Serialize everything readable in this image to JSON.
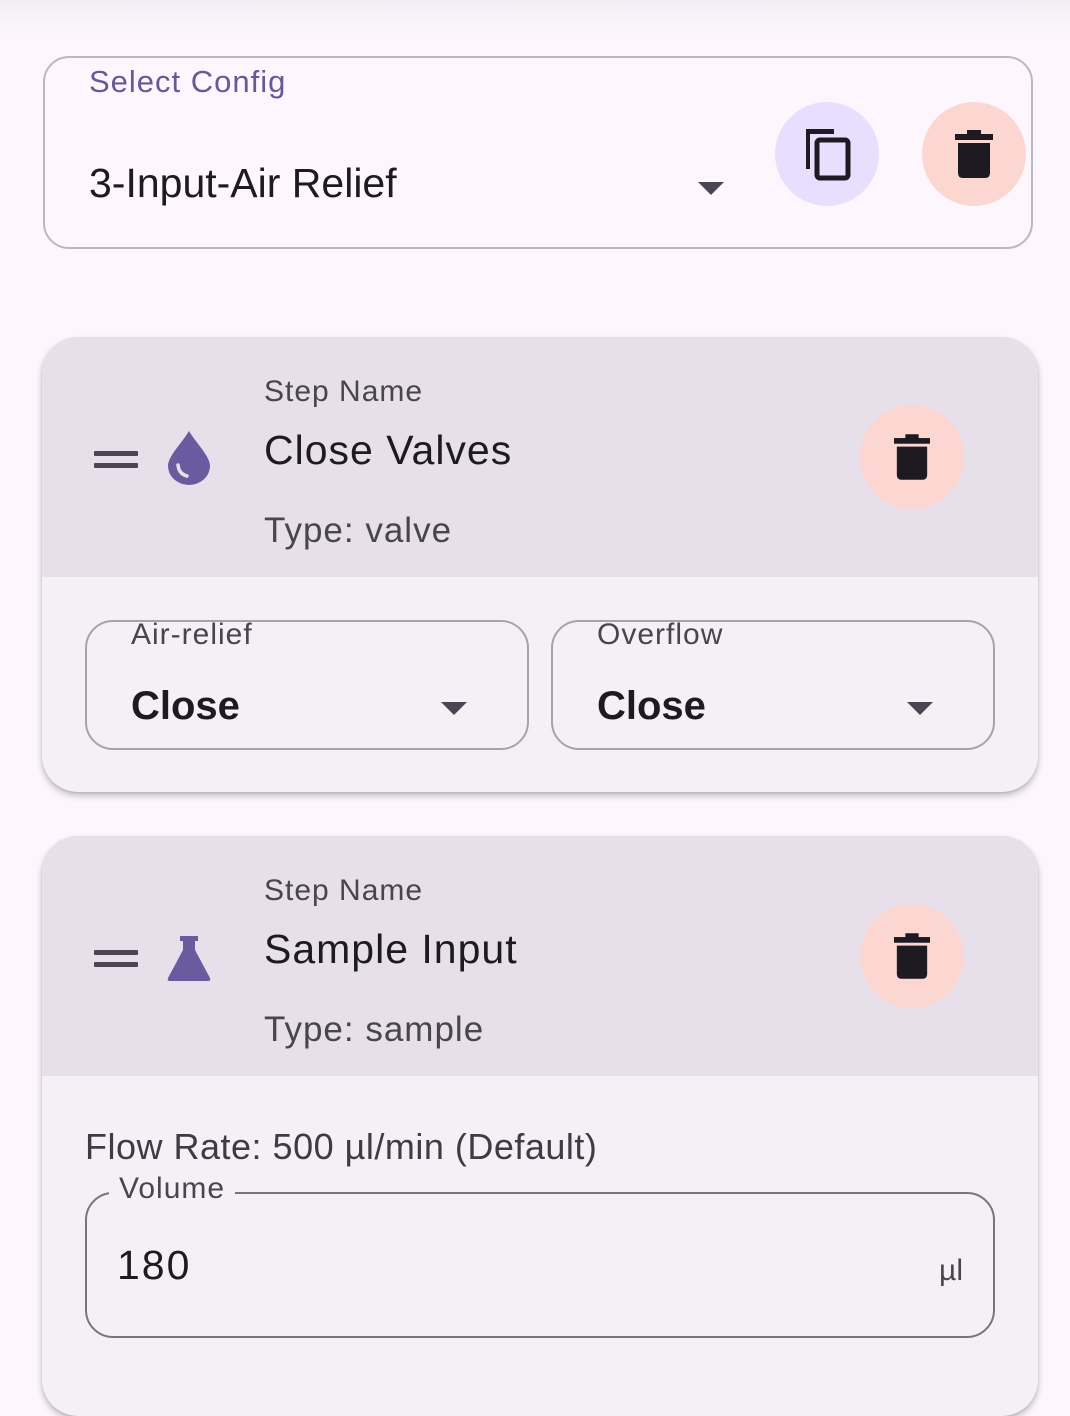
{
  "config": {
    "label": "Select Config",
    "selected": "3-Input-Air Relief",
    "copy_icon": "copy-icon",
    "delete_icon": "trash-icon"
  },
  "steps": [
    {
      "name_label": "Step Name",
      "name": "Close Valves",
      "type_text": "Type: valve",
      "icon": "water-drop-icon",
      "valves": [
        {
          "label": "Air-relief",
          "value": "Close"
        },
        {
          "label": "Overflow",
          "value": "Close"
        }
      ]
    },
    {
      "name_label": "Step Name",
      "name": "Sample Input",
      "type_text": "Type: sample",
      "icon": "flask-icon",
      "flow_rate": "Flow Rate: 500 µl/min (Default)",
      "volume": {
        "label": "Volume",
        "value": "180",
        "unit": "µl"
      }
    }
  ],
  "colors": {
    "background": "#fdf7fd",
    "card_header": "#e7dfea",
    "card_body": "#f3f1f5",
    "accent": "#675896",
    "copy_button": "#e8defe",
    "delete_button": "#fcd7d1"
  }
}
